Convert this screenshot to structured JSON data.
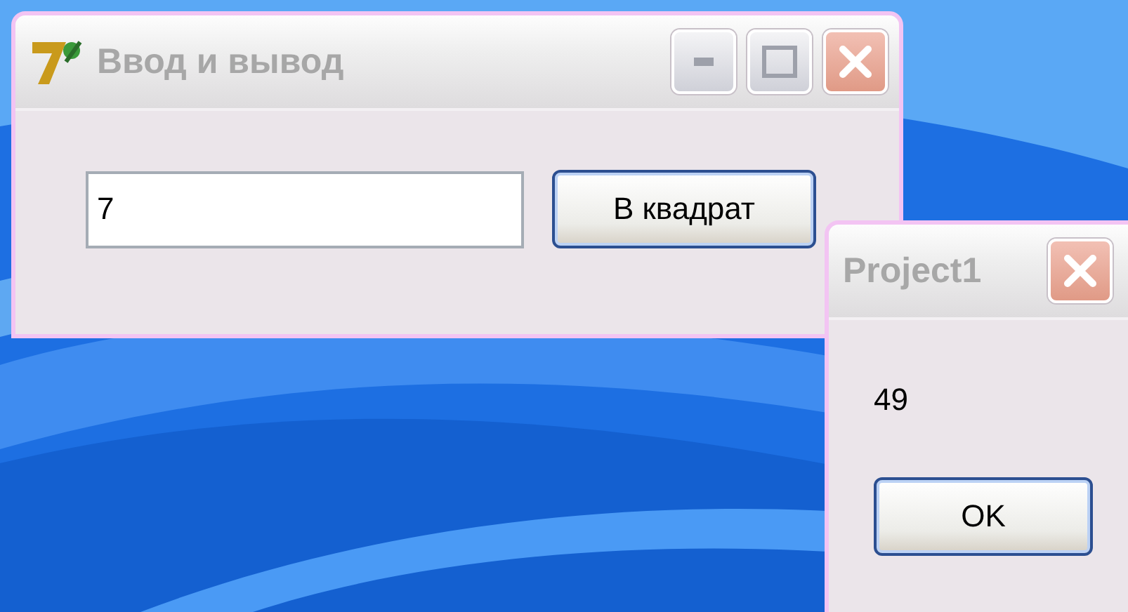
{
  "main_window": {
    "title": "Ввод и вывод",
    "input": {
      "value": "7"
    },
    "button": "В квадрат"
  },
  "dialog": {
    "title": "Project1",
    "message": "49",
    "button": "OK"
  }
}
